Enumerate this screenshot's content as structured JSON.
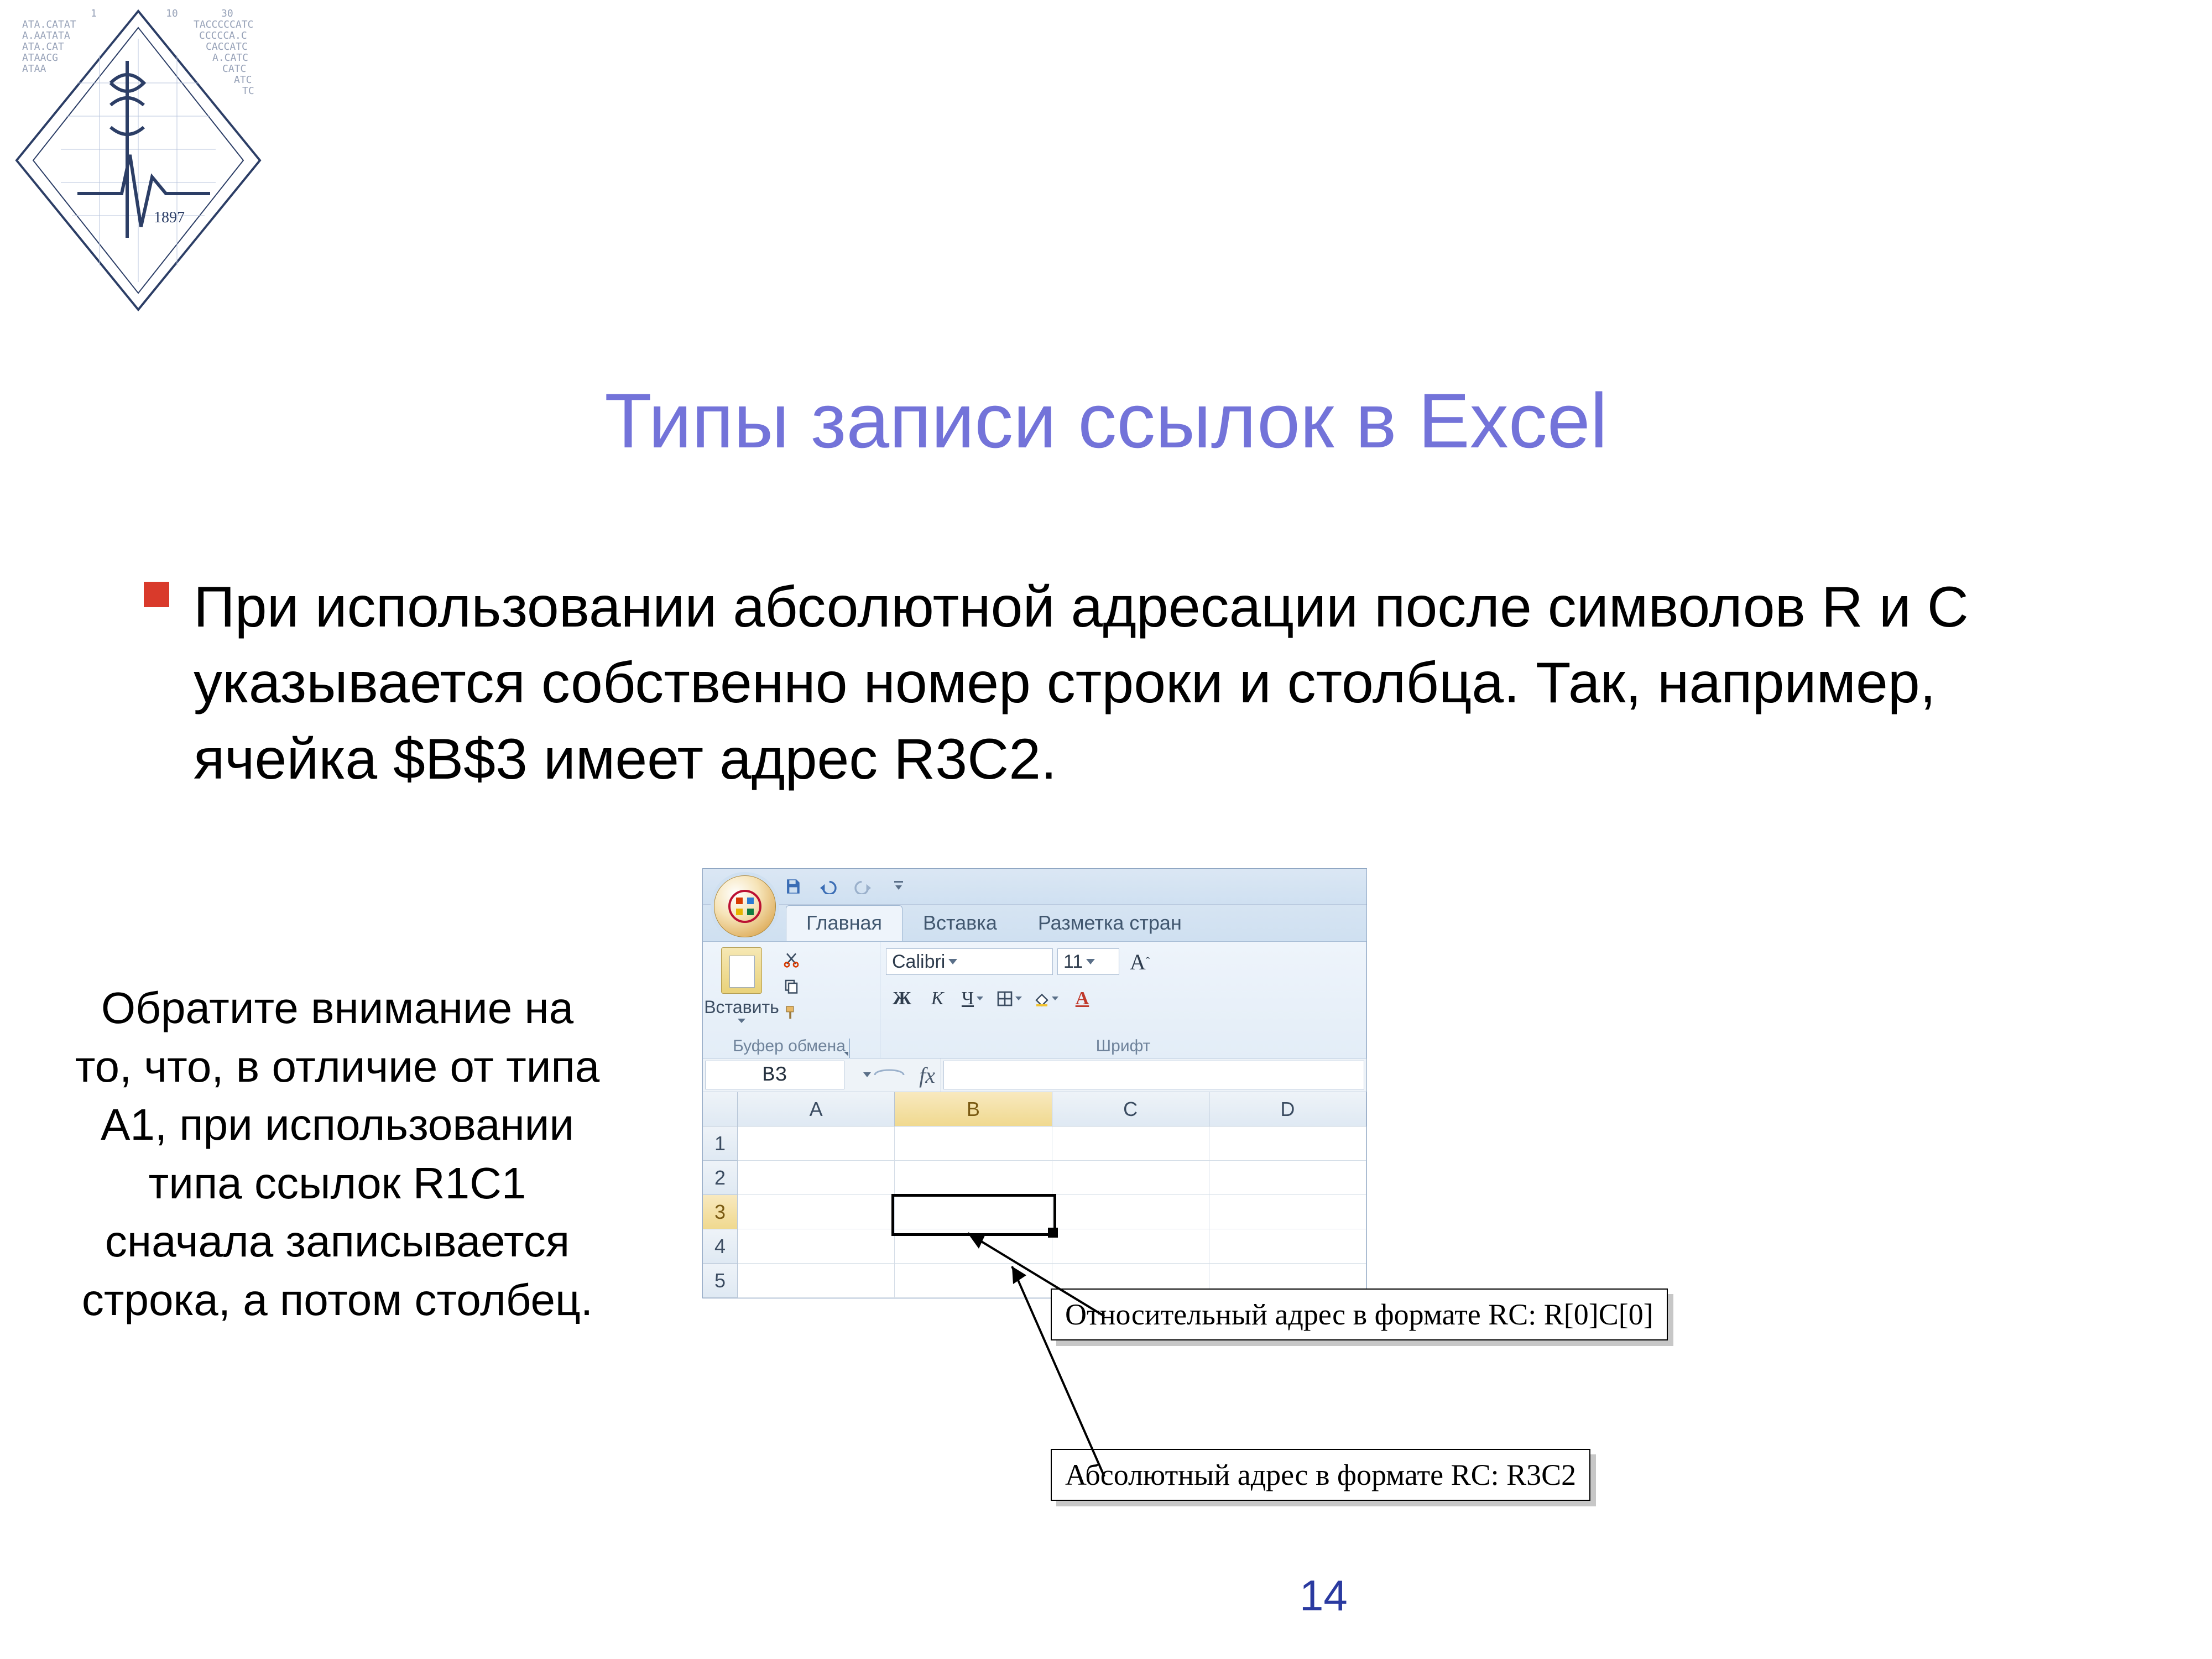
{
  "title": "Типы записи ссылок в Excel",
  "bullet_text": "При использовании абсолютной адресации после символов R и C указывается собственно номер строки и столбца. Так, например, ячейка $B$3 имеет адрес R3C2.",
  "note_text": "Обратите внимание на то, что, в отличие от типа A1, при использовании типа ссылок R1C1 сначала записывается строка, а потом столбец.",
  "page_number": "14",
  "excel": {
    "tabs": {
      "home": "Главная",
      "insert": "Вставка",
      "layout": "Разметка стран"
    },
    "ribbon": {
      "clipboard_label": "Буфер обмена",
      "paste_label": "Вставить",
      "font_label": "Шрифт",
      "font_name": "Calibri",
      "font_size": "11",
      "bold": "Ж",
      "italic": "К",
      "underline": "Ч",
      "grow_font": "A"
    },
    "namebox": "B3",
    "fx": "fx",
    "columns": [
      "A",
      "B",
      "C",
      "D"
    ],
    "rows": [
      "1",
      "2",
      "3",
      "4",
      "5"
    ],
    "selected": {
      "col": "B",
      "row": "3"
    }
  },
  "callouts": {
    "relative": "Относительный адрес в формате RC: R[0]C[0]",
    "absolute": "Абсолютный адрес в формате RC: R3C2"
  }
}
